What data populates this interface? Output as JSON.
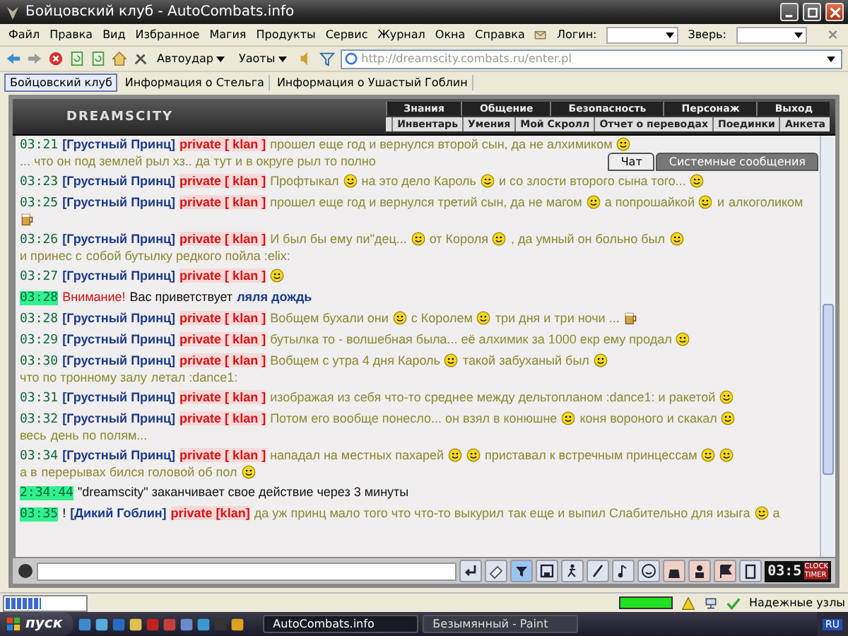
{
  "window": {
    "title": "Бойцовский клуб - AutoCombats.info"
  },
  "menu": [
    "Файл",
    "Правка",
    "Вид",
    "Избранное",
    "Магия",
    "Продукты",
    "Сервис",
    "Журнал",
    "Окна",
    "Справка"
  ],
  "login": {
    "label": "Логин:"
  },
  "pet": {
    "label": "Зверь:"
  },
  "toolbar": {
    "buttons": [
      "Автоудар",
      "Уаоты"
    ],
    "address": "http://dreamscity.combats.ru/enter.pl"
  },
  "tabs": [
    {
      "label": "Бойцовский клуб",
      "selected": true
    },
    {
      "label": "Информация о Стельга",
      "selected": false
    },
    {
      "label": "Информация о Ушастый Гоблин",
      "selected": false
    }
  ],
  "game": {
    "logo": "DREAMSCITY",
    "nav_top": [
      "Знания",
      "Общение",
      "Безопасность",
      "Персонаж",
      "Выход"
    ],
    "nav_bottom": [
      "Инвентарь",
      "Умения",
      "Мой Скролл",
      "Отчет о переводах",
      "Поединки",
      "Анкета"
    ]
  },
  "chat_tabs": [
    {
      "label": "Чат",
      "selected": true
    },
    {
      "label": "Системные сообщения",
      "selected": false
    }
  ],
  "messages": [
    {
      "kind": "private",
      "time": "03:21",
      "marked": false,
      "author": "[Грустный Принц]",
      "channel": "private [ klan ]",
      "parts": [
        {
          "kind": "text",
          "text": "прошел еще год и вернулся второй сын, да не алхимиком"
        },
        {
          "kind": "smiley"
        },
        {
          "kind": "text",
          "text": "... что он под землей рыл хз.. да тут и в округе рыл то полно"
        }
      ]
    },
    {
      "kind": "private",
      "time": "03:23",
      "marked": false,
      "author": "[Грустный Принц]",
      "channel": "private [ klan ]",
      "parts": [
        {
          "kind": "text",
          "text": "Профтыкал"
        },
        {
          "kind": "smiley"
        },
        {
          "kind": "text",
          "text": "на это дело Кароль"
        },
        {
          "kind": "smiley"
        },
        {
          "kind": "text",
          "text": "и со злости второго сына того..."
        },
        {
          "kind": "smiley"
        }
      ]
    },
    {
      "kind": "private",
      "time": "03:25",
      "marked": false,
      "author": "[Грустный Принц]",
      "channel": "private [ klan ]",
      "parts": [
        {
          "kind": "text",
          "text": "прошел еще год и вернулся третий сын, да не магом"
        },
        {
          "kind": "smiley"
        },
        {
          "kind": "text",
          "text": "а попрошайкой"
        },
        {
          "kind": "smiley"
        },
        {
          "kind": "text",
          "text": "и"
        },
        {
          "kind": "text",
          "text": "алкоголиком"
        },
        {
          "kind": "mug"
        }
      ]
    },
    {
      "kind": "private",
      "time": "03:26",
      "marked": false,
      "author": "[Грустный Принц]",
      "channel": "private [ klan ]",
      "parts": [
        {
          "kind": "text",
          "text": "И был бы ему пи\"дец..."
        },
        {
          "kind": "smiley"
        },
        {
          "kind": "text",
          "text": "от Короля"
        },
        {
          "kind": "smiley"
        },
        {
          "kind": "text",
          "text": ", да умный он больно был"
        },
        {
          "kind": "smiley"
        },
        {
          "kind": "text",
          "text": "и принес с"
        },
        {
          "kind": "text",
          "text": "собой бутылку редкого пойла :elix:"
        }
      ]
    },
    {
      "kind": "private",
      "time": "03:27",
      "marked": false,
      "author": "[Грустный Принц]",
      "channel": "private [ klan ]",
      "parts": [
        {
          "kind": "smiley"
        }
      ]
    },
    {
      "kind": "system",
      "time": "03:28",
      "marked": true,
      "alert": "Внимание!",
      "text": "Вас приветствует",
      "name": "ляля дождь"
    },
    {
      "kind": "private",
      "time": "03:28",
      "marked": false,
      "author": "[Грустный Принц]",
      "channel": "private [ klan ]",
      "parts": [
        {
          "kind": "text",
          "text": "Вобщем бухали они"
        },
        {
          "kind": "smiley"
        },
        {
          "kind": "text",
          "text": "с Королем"
        },
        {
          "kind": "smiley"
        },
        {
          "kind": "text",
          "text": "три дня и три ночи ..."
        },
        {
          "kind": "mug"
        }
      ]
    },
    {
      "kind": "private",
      "time": "03:29",
      "marked": false,
      "author": "[Грустный Принц]",
      "channel": "private [ klan ]",
      "parts": [
        {
          "kind": "text",
          "text": "бутылка то - волшебная была... её алхимик за 1000 екр ему продал"
        },
        {
          "kind": "smiley"
        }
      ]
    },
    {
      "kind": "private",
      "time": "03:30",
      "marked": false,
      "author": "[Грустный Принц]",
      "channel": "private [ klan ]",
      "parts": [
        {
          "kind": "text",
          "text": "Вобщем с утра 4 дня Кароль"
        },
        {
          "kind": "smiley"
        },
        {
          "kind": "text",
          "text": "такой забуханый был"
        },
        {
          "kind": "smiley"
        },
        {
          "kind": "text",
          "text": "что по тронному залу"
        },
        {
          "kind": "text",
          "text": "летал :dance1:"
        }
      ]
    },
    {
      "kind": "private",
      "time": "03:31",
      "marked": false,
      "author": "[Грустный Принц]",
      "channel": "private [ klan ]",
      "parts": [
        {
          "kind": "text",
          "text": "изображая из себя что-то среднее между дельтопланом :dance1: и ракетой"
        },
        {
          "kind": "smiley"
        }
      ]
    },
    {
      "kind": "private",
      "time": "03:32",
      "marked": false,
      "author": "[Грустный Принц]",
      "channel": "private [ klan ]",
      "parts": [
        {
          "kind": "text",
          "text": "Потом его вообще понесло... он взял в конюшне"
        },
        {
          "kind": "smiley"
        },
        {
          "kind": "text",
          "text": "коня вороного и скакал"
        },
        {
          "kind": "smiley"
        },
        {
          "kind": "text",
          "text": "весь"
        },
        {
          "kind": "text",
          "text": "день по полям..."
        }
      ]
    },
    {
      "kind": "private",
      "time": "03:34",
      "marked": false,
      "author": "[Грустный Принц]",
      "channel": "private [ klan ]",
      "parts": [
        {
          "kind": "text",
          "text": "нападал на местных пахарей"
        },
        {
          "kind": "smiley"
        },
        {
          "kind": "smiley"
        },
        {
          "kind": "text",
          "text": "приставал к встречным принцессам"
        },
        {
          "kind": "smiley"
        },
        {
          "kind": "smiley"
        },
        {
          "kind": "text",
          "text": "а в"
        },
        {
          "kind": "text",
          "text": "перерывах бился головой об пол"
        },
        {
          "kind": "smiley"
        }
      ]
    },
    {
      "kind": "notice",
      "time": "2:34:44",
      "marked": true,
      "text": "\"dreamscity\" заканчивает свое действие через 3 минуты"
    },
    {
      "kind": "private",
      "time": "03:35",
      "marked": true,
      "flag": "!",
      "author": "[Дикий Гоблин]",
      "channel": "private [klan]",
      "parts": [
        {
          "kind": "text",
          "text": "да уж принц мало того что что-то выкурил"
        },
        {
          "kind": "text",
          "text": "так еще и выпил Слабительно для изыга"
        },
        {
          "kind": "smiley"
        },
        {
          "kind": "text",
          "text": "а"
        }
      ]
    }
  ],
  "clock": {
    "time": "03:5",
    "labels": [
      "CLOCK",
      "TIMER"
    ]
  },
  "status_bar": {
    "progress": {
      "level": 0.45
    },
    "zone": "Надежные узлы"
  },
  "taskbar": {
    "start": "пуск",
    "tasks": [
      {
        "label": "AutoCombats.info",
        "selected": true
      },
      {
        "label": "Безымянный - Paint",
        "selected": false
      }
    ],
    "language": "RU"
  }
}
